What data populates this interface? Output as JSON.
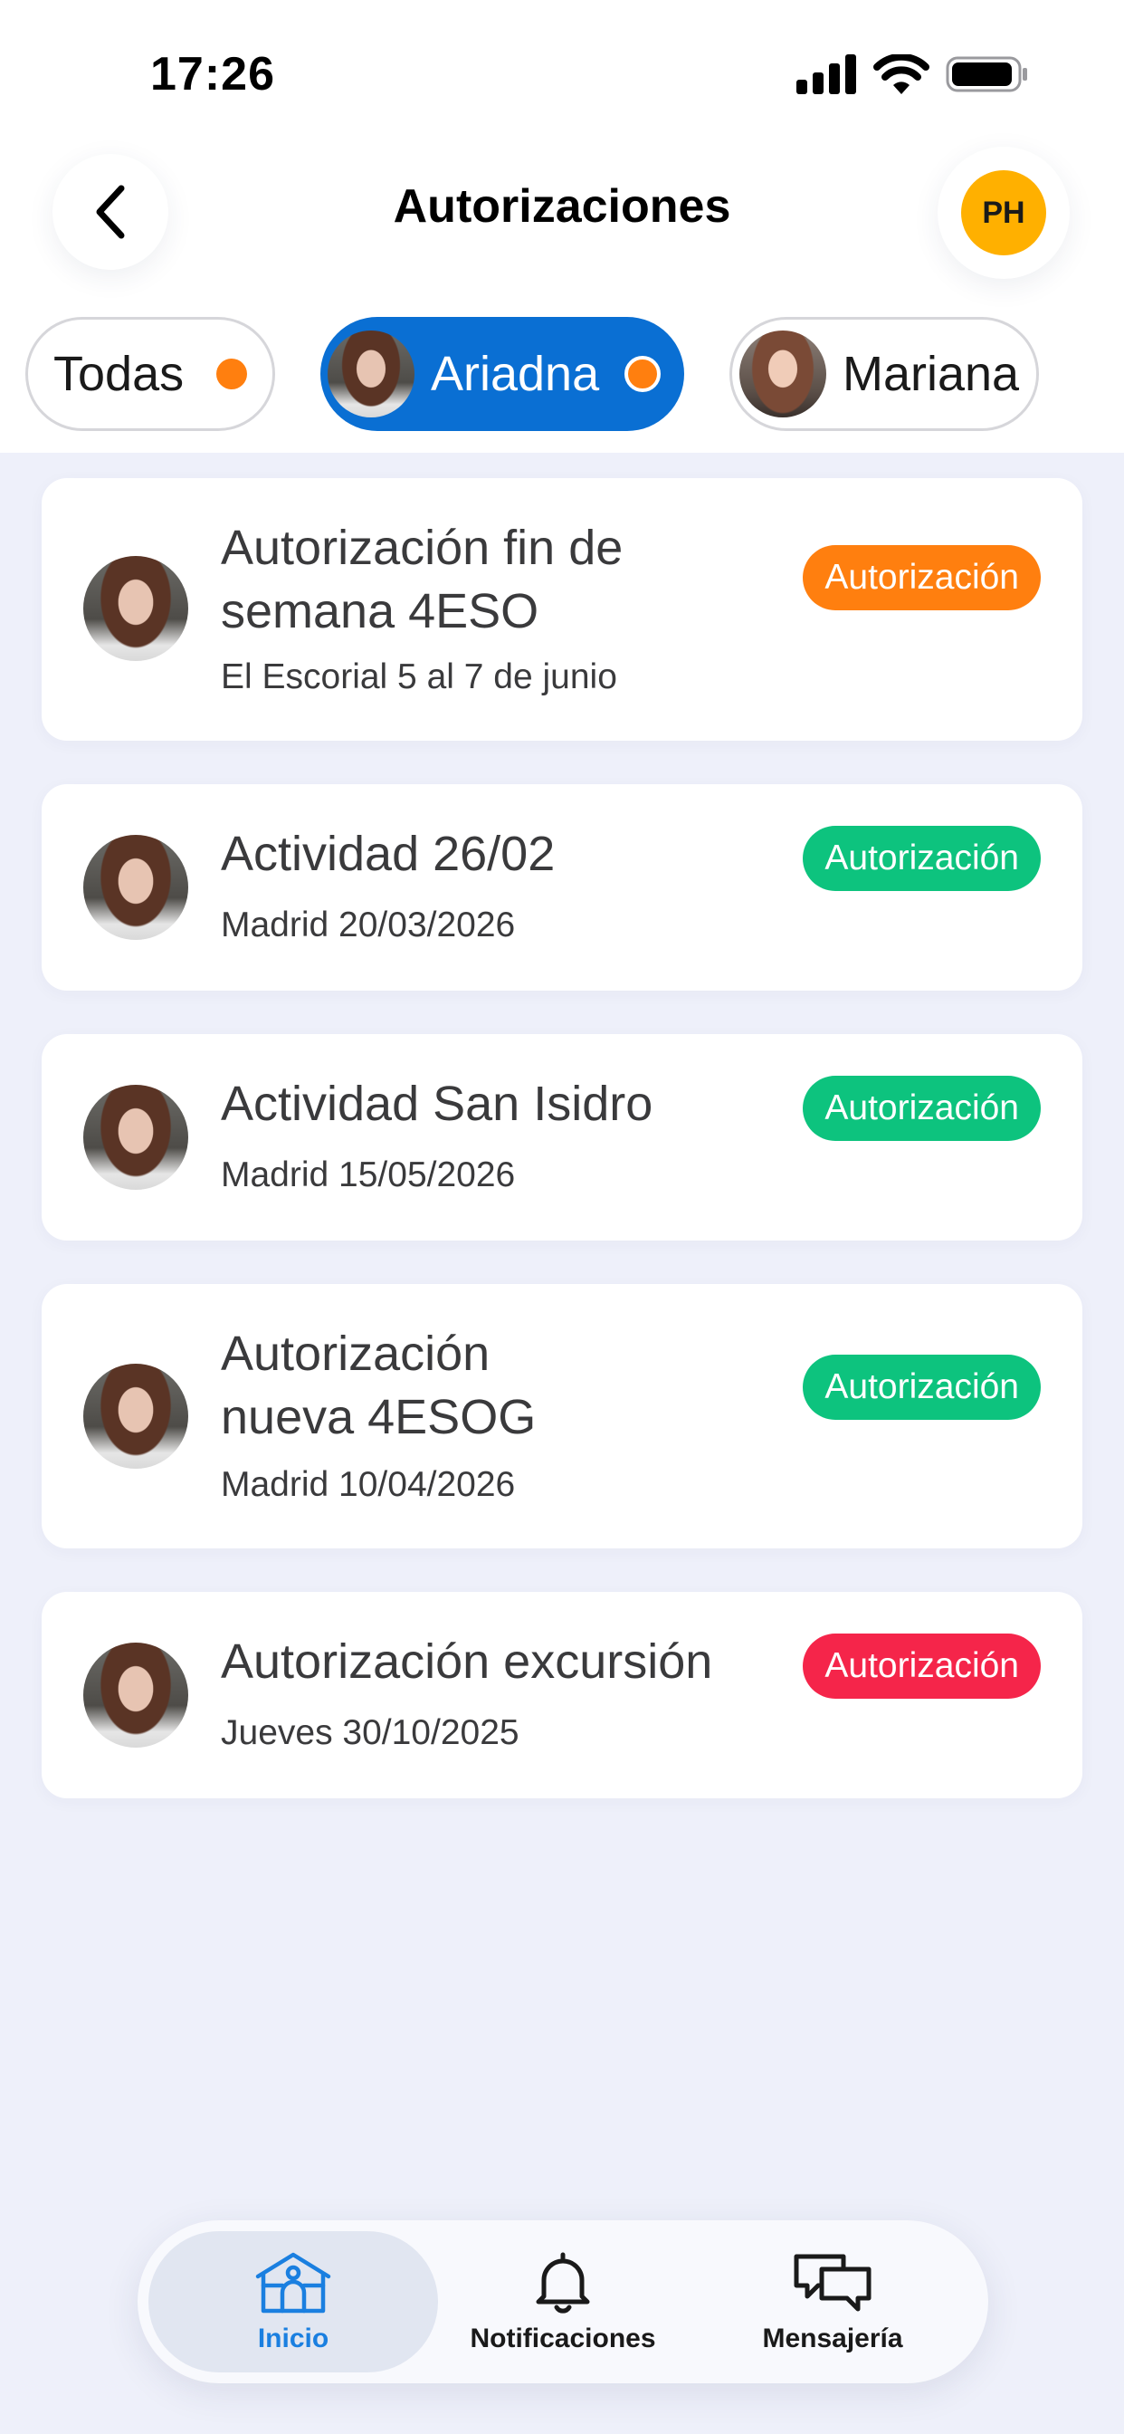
{
  "status_bar": {
    "time": "17:26"
  },
  "header": {
    "title": "Autorizaciones",
    "profile_initials": "PH"
  },
  "filters": [
    {
      "label": "Todas",
      "selected": false,
      "has_dot": true
    },
    {
      "label": "Ariadna",
      "selected": true,
      "has_dot": true
    },
    {
      "label": "Mariana",
      "selected": false,
      "has_dot": false
    }
  ],
  "cards": [
    {
      "title": "Autorización fin de semana 4ESO",
      "subtitle": "El Escorial 5 al 7 de junio",
      "badge": "Autorización",
      "badge_color": "#ff7f0f"
    },
    {
      "title": "Actividad 26/02",
      "subtitle": "Madrid 20/03/2026",
      "badge": "Autorización",
      "badge_color": "#0dc37e"
    },
    {
      "title": "Actividad San Isidro",
      "subtitle": "Madrid 15/05/2026",
      "badge": "Autorización",
      "badge_color": "#0dc37e"
    },
    {
      "title": "Autorización nueva 4ESOG",
      "subtitle": "Madrid 10/04/2026",
      "badge": "Autorización",
      "badge_color": "#0dc37e"
    },
    {
      "title": "Autorización excursión",
      "subtitle": "Jueves 30/10/2025",
      "badge": "Autorización",
      "badge_color": "#f5254a"
    }
  ],
  "bottom_nav": {
    "items": [
      {
        "label": "Inicio",
        "icon": "home-icon",
        "active": true
      },
      {
        "label": "Notificaciones",
        "icon": "bell-icon",
        "active": false
      },
      {
        "label": "Mensajería",
        "icon": "chat-icon",
        "active": false
      }
    ]
  },
  "colors": {
    "accent": "#0a6fd3",
    "dot": "#ff7f0f",
    "badge_orange": "#ff7f0f",
    "badge_green": "#0dc37e",
    "badge_red": "#f5254a",
    "nav_active": "#1a7fe0",
    "background": "#eef0fa"
  }
}
